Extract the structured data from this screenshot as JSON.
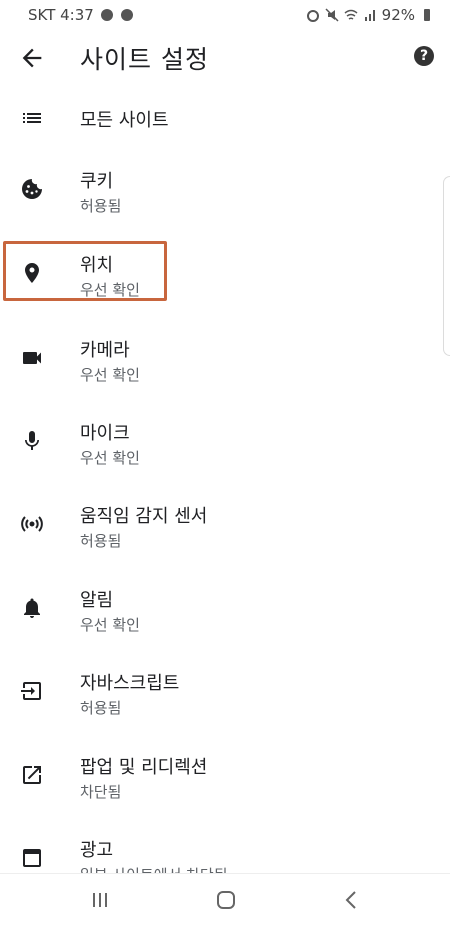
{
  "status_bar": {
    "carrier_time": "SKT 4:37",
    "battery": "92%"
  },
  "app_bar": {
    "title": "사이트 설정",
    "back_icon": "arrow-back-icon",
    "help_icon": "help-icon",
    "help_glyph": "?"
  },
  "items": [
    {
      "label": "모든 사이트",
      "icon": "list-icon"
    },
    {
      "label": "쿠키",
      "subtitle": "허용됨",
      "icon": "cookie-icon"
    },
    {
      "label": "위치",
      "subtitle": "우선 확인",
      "icon": "location-pin-icon"
    },
    {
      "label": "카메라",
      "subtitle": "우선 확인",
      "icon": "videocam-icon"
    },
    {
      "label": "마이크",
      "subtitle": "우선 확인",
      "icon": "mic-icon"
    },
    {
      "label": "움직임 감지 센서",
      "subtitle": "허용됨",
      "icon": "sensors-icon"
    },
    {
      "label": "알림",
      "subtitle": "우선 확인",
      "icon": "bell-icon"
    },
    {
      "label": "자바스크립트",
      "subtitle": "허용됨",
      "icon": "javascript-icon"
    },
    {
      "label": "팝업 및 리디렉션",
      "subtitle": "차단됨",
      "icon": "open-in-new-icon"
    },
    {
      "label": "광고",
      "subtitle": "일부 사이트에서 차단됨",
      "icon": "window-icon"
    }
  ],
  "nav_bar": {
    "recents_icon": "recents-icon",
    "home_icon": "home-icon",
    "back_icon": "back-chevron-icon"
  }
}
